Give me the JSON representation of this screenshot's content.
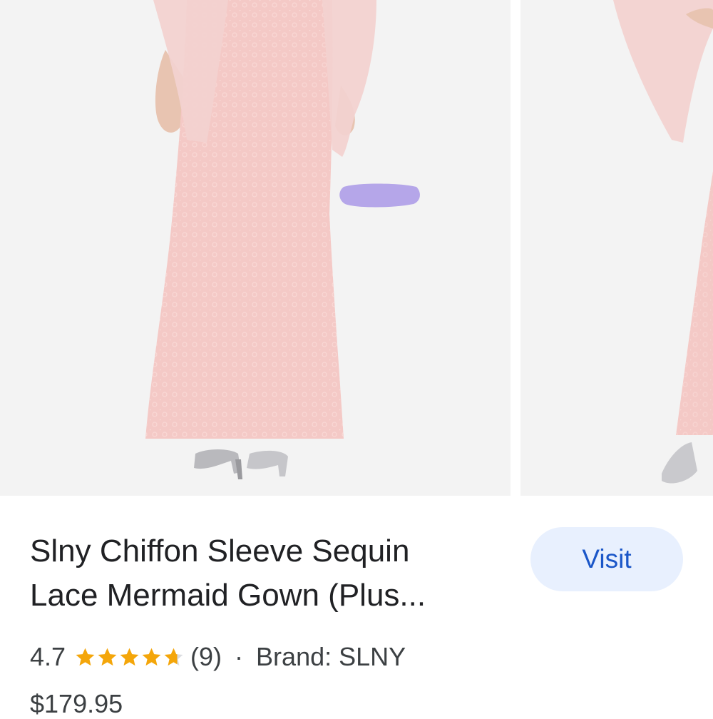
{
  "product": {
    "title_line1": "Slny Chiffon Sleeve Sequin",
    "title_line2": "Lace Mermaid Gown (Plus...",
    "rating": "4.7",
    "rating_value": 4.7,
    "rating_max": 5,
    "review_count": "(9)",
    "separator": "·",
    "brand": "Brand: SLNY",
    "price": "$179.95"
  },
  "actions": {
    "visit_label": "Visit"
  },
  "icons": {
    "star": "star-icon"
  },
  "colors": {
    "star": "#f4a60a",
    "visit_bg": "#e8f0fe",
    "visit_text": "#1a56c8",
    "dress": "#f3c7c4",
    "highlight_mark": "#a998e6"
  }
}
